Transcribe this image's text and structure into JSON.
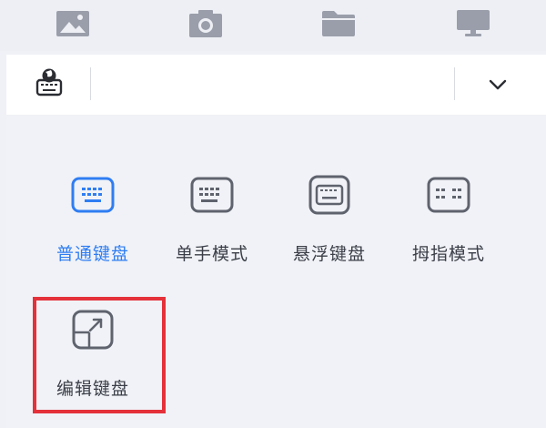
{
  "top_toolbar": {
    "icons": [
      "image-icon",
      "camera-icon",
      "folder-icon",
      "monitor-icon"
    ]
  },
  "ime_bar": {
    "left_icon": "keyboard-globe-icon",
    "right_icon": "chevron-down-icon"
  },
  "keyboard_modes": [
    {
      "label": "普通键盘",
      "icon": "keyboard-standard-icon",
      "active": true
    },
    {
      "label": "单手模式",
      "icon": "keyboard-one-hand-icon",
      "active": false
    },
    {
      "label": "悬浮键盘",
      "icon": "keyboard-floating-icon",
      "active": false
    },
    {
      "label": "拇指模式",
      "icon": "keyboard-thumb-icon",
      "active": false
    },
    {
      "label": "编辑键盘",
      "icon": "edit-keyboard-icon",
      "active": false
    }
  ],
  "colors": {
    "accent": "#2f7df2",
    "text": "#3b3e47",
    "icon_gray": "#5f636d",
    "toolbar_icon": "#9a9eaa",
    "highlight": "#e4313a"
  }
}
